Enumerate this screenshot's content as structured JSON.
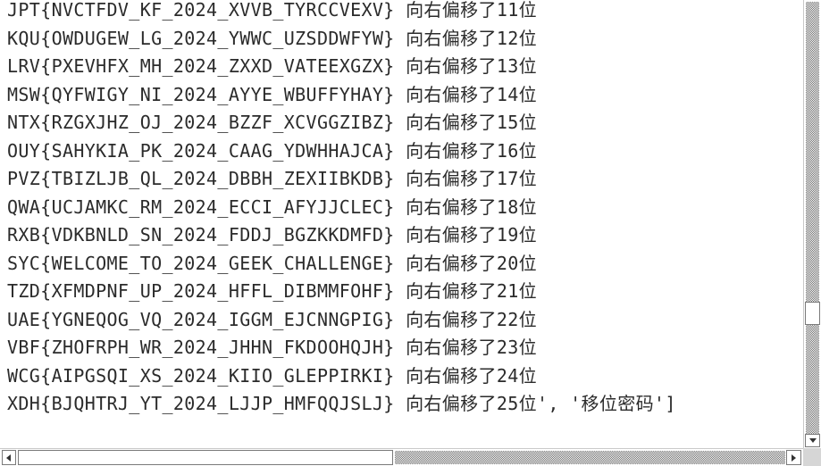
{
  "output": {
    "lines": [
      "JPT{NVCTFDV_KF_2024_XVVB_TYRCCVEXV} 向右偏移了11位",
      "KQU{OWDUGEW_LG_2024_YWWC_UZSDDWFYW} 向右偏移了12位",
      "LRV{PXEVHFX_MH_2024_ZXXD_VATEEXGZX} 向右偏移了13位",
      "MSW{QYFWIGY_NI_2024_AYYE_WBUFFYHAY} 向右偏移了14位",
      "NTX{RZGXJHZ_OJ_2024_BZZF_XCVGGZIBZ} 向右偏移了15位",
      "OUY{SAHYKIA_PK_2024_CAAG_YDWHHAJCA} 向右偏移了16位",
      "PVZ{TBIZLJB_QL_2024_DBBH_ZEXIIBKDB} 向右偏移了17位",
      "QWA{UCJAMKC_RM_2024_ECCI_AFYJJCLEC} 向右偏移了18位",
      "RXB{VDKBNLD_SN_2024_FDDJ_BGZKKDMFD} 向右偏移了19位",
      "SYC{WELCOME_TO_2024_GEEK_CHALLENGE} 向右偏移了20位",
      "TZD{XFMDPNF_UP_2024_HFFL_DIBMMFOHF} 向右偏移了21位",
      "UAE{YGNEQOG_VQ_2024_IGGM_EJCNNGPIG} 向右偏移了22位",
      "VBF{ZHOFRPH_WR_2024_JHHN_FKDOOHQJH} 向右偏移了23位",
      "WCG{AIPGSQI_XS_2024_KIIO_GLEPPIRKI} 向右偏移了24位",
      "XDH{BJQHTRJ_YT_2024_LJJP_HMFQQJSLJ} 向右偏移了25位', '移位密码']"
    ]
  },
  "scrollbars": {
    "vertical": {
      "up_icon": "none-visible",
      "down_icon": "arrow-down-icon"
    },
    "horizontal": {
      "left_icon": "arrow-left-icon",
      "right_icon": "arrow-right-icon"
    }
  },
  "colors": {
    "text": "#2b2b2b",
    "background": "#ffffff",
    "scrollbar_track": "#6f6f6f"
  }
}
